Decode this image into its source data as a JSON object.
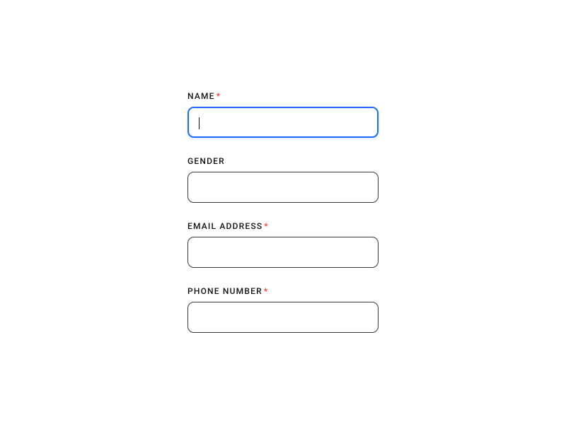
{
  "form": {
    "fields": [
      {
        "label": "NAME",
        "required": true,
        "value": "",
        "focused": true
      },
      {
        "label": "GENDER",
        "required": false,
        "value": "",
        "focused": false
      },
      {
        "label": "EMAIL ADDRESS",
        "required": true,
        "value": "",
        "focused": false
      },
      {
        "label": "PHONE NUMBER",
        "required": true,
        "value": "",
        "focused": false
      }
    ],
    "required_mark": "*"
  }
}
